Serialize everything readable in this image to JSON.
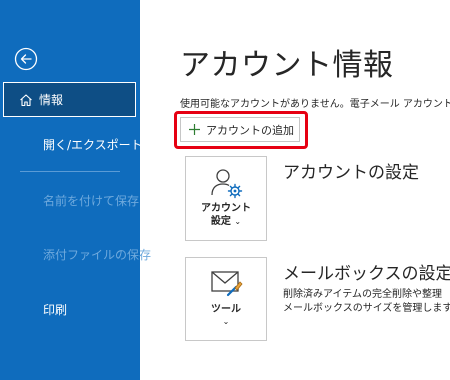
{
  "sidebar": {
    "info_label": "情報",
    "items": [
      {
        "label": "開く/エクスポート",
        "enabled": true
      },
      {
        "label": "名前を付けて保存",
        "enabled": false
      },
      {
        "label": "添付ファイルの保存",
        "enabled": false
      },
      {
        "label": "印刷",
        "enabled": true
      }
    ],
    "background_color": "#0f6cbd",
    "selected_color": "#0e4e85"
  },
  "main": {
    "title": "アカウント情報",
    "no_account_text": "使用可能なアカウントがありません。電子メール アカウントを",
    "add_account_label": "アカウントの追加",
    "highlight_color": "#e60012",
    "account_settings": {
      "tile_label_line1": "アカウント",
      "tile_label_line2": "設定",
      "section_title": "アカウントの設定"
    },
    "mailbox_settings": {
      "tile_label": "ツール",
      "section_title": "メールボックスの設定",
      "description_line1": "削除済みアイテムの完全削除や整理",
      "description_line2": "メールボックスのサイズを管理します。"
    }
  },
  "icons": {
    "back": "back-arrow-icon",
    "home": "home-icon",
    "plus": "plus-icon",
    "account_settings": "account-settings-icon",
    "tools": "mailbox-tools-icon"
  }
}
